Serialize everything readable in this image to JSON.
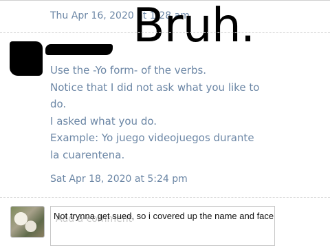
{
  "post": {
    "timestamp": "Thu Apr 16, 2020 at 1:28 am"
  },
  "overlay": {
    "meme_text": "Bruh.",
    "caption": "Not trynna get sued, so i covered up the name and face"
  },
  "reply": {
    "lines": [
      "Use the -Yo form- of the verbs.",
      "Notice that I did not ask what you like to",
      "do.",
      "I asked what you do.",
      "Example: Yo juego videojuegos durante",
      "la cuarentena."
    ],
    "timestamp": "Sat Apr 18, 2020 at 5:24 pm"
  },
  "comment_input": {
    "placeholder": "Add a comment"
  },
  "colors": {
    "text_blue": "#6b86a5",
    "redaction": "#000000"
  }
}
